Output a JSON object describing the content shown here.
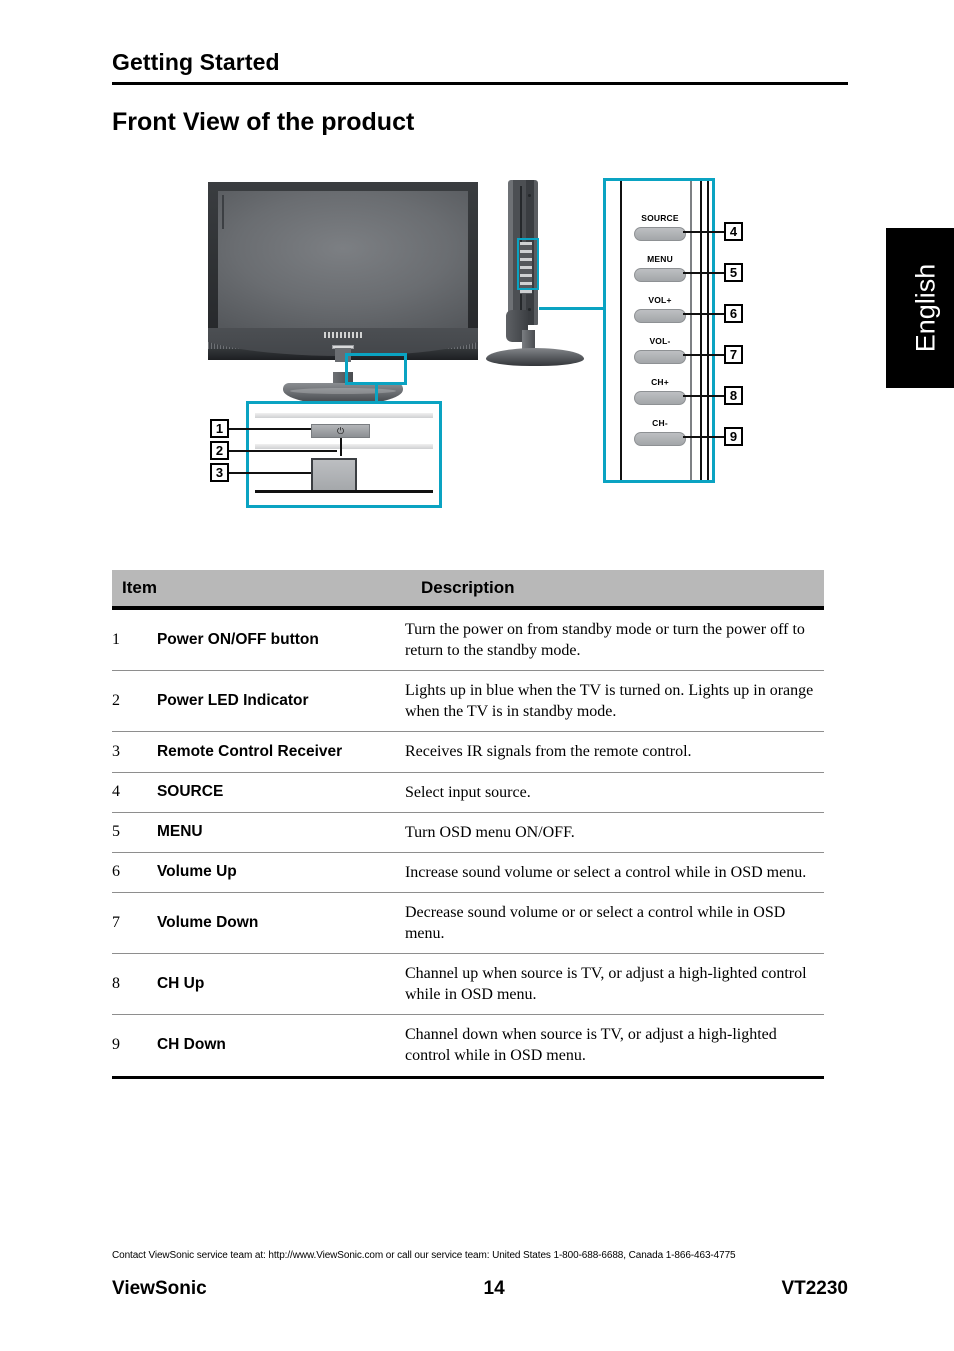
{
  "header": {
    "section_title": "Getting Started",
    "page_title": "Front View of the product"
  },
  "language_tab": {
    "label": "English"
  },
  "figure": {
    "accent_color": "#0aa3c2",
    "front_view_callouts": [
      {
        "number": "1"
      },
      {
        "number": "2"
      },
      {
        "number": "3"
      }
    ],
    "power_icon": "⏻",
    "control_panel": {
      "buttons": [
        {
          "label": "SOURCE",
          "number": "4"
        },
        {
          "label": "MENU",
          "number": "5"
        },
        {
          "label": "VOL+",
          "number": "6"
        },
        {
          "label": "VOL-",
          "number": "7"
        },
        {
          "label": "CH+",
          "number": "8"
        },
        {
          "label": "CH-",
          "number": "9"
        }
      ]
    }
  },
  "table": {
    "headers": {
      "item": "Item",
      "description": "Description"
    },
    "rows": [
      {
        "num": "1",
        "item": "Power ON/OFF button",
        "desc": "Turn the power on from standby mode or turn the power off to return to the standby mode."
      },
      {
        "num": "2",
        "item": "Power LED Indicator",
        "desc": "Lights up in blue when the TV is turned on. Lights up in orange when the TV is in standby mode."
      },
      {
        "num": "3",
        "item": "Remote Control Receiver",
        "desc": "Receives IR signals from the remote control."
      },
      {
        "num": "4",
        "item": "SOURCE",
        "desc": "Select input source."
      },
      {
        "num": "5",
        "item": "MENU",
        "desc": "Turn OSD menu ON/OFF."
      },
      {
        "num": "6",
        "item": "Volume Up",
        "desc": "Increase sound volume or select a control while in OSD menu."
      },
      {
        "num": "7",
        "item": "Volume Down",
        "desc": "Decrease sound volume or or select a control while in OSD menu."
      },
      {
        "num": "8",
        "item": "CH Up",
        "desc": "Channel up when source is TV, or adjust a high-lighted control while in OSD menu."
      },
      {
        "num": "9",
        "item": "CH Down",
        "desc": "Channel down when source is TV, or adjust a high-lighted control while in OSD menu."
      }
    ]
  },
  "footer": {
    "contact": "Contact ViewSonic service team at: http://www.ViewSonic.com or call our service team: United States 1-800-688-6688, Canada 1-866-463-4775",
    "brand": "ViewSonic",
    "page_number": "14",
    "model": "VT2230"
  }
}
